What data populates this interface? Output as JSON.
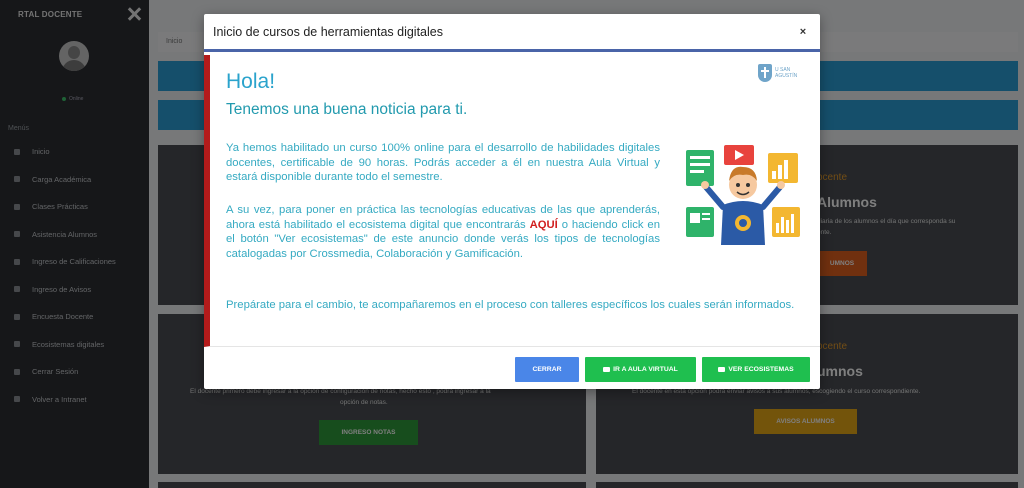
{
  "sidebar": {
    "brand": "RTAL DOCENTE",
    "status": "Online",
    "menu_title": "Menús",
    "items": [
      {
        "label": "Inicio"
      },
      {
        "label": "Carga Académica"
      },
      {
        "label": "Clases Prácticas"
      },
      {
        "label": "Asistencia Alumnos"
      },
      {
        "label": "Ingreso de Calificaciones"
      },
      {
        "label": "Ingreso de Avisos"
      },
      {
        "label": "Encuesta Docente"
      },
      {
        "label": "Ecosistemas digitales"
      },
      {
        "label": "Cerrar Sesión"
      },
      {
        "label": "Volver a Intranet"
      }
    ]
  },
  "main": {
    "breadcrumb": "Inicio",
    "card_r1": {
      "tag": "ocente",
      "title": "Alumnos",
      "text_line1": "diaria de los alumnos el día que corresponda su",
      "text_line2": "ente.",
      "button": "UMNOS"
    },
    "card_l2": {
      "text_line1": "El docente primero debe ingresar a la opción de configuración de notas, hecho esto , podrá ingresar a la",
      "text_line2": "opción de notas.",
      "button": "INGRESO NOTAS"
    },
    "card_r2": {
      "tag": "ocente",
      "title": "umnos",
      "text_line1": "El docente en esta opción podrá enviar avisos a sus alumnos, escogiendo el curso correspondiente.",
      "button": "AVISOS ALUMNOS"
    }
  },
  "modal": {
    "title": "Inicio de cursos de herramientas digitales",
    "close": "×",
    "logo_text_1": "U SAN",
    "logo_text_2": "AGUSTÍN",
    "greeting": "Hola!",
    "subtitle": "Tenemos una buena noticia para ti.",
    "paragraph1": "Ya hemos habilitado un curso 100% online para el desarrollo de habilidades digitales docentes, certificable de 90 horas. Podrás acceder a él en nuestra Aula Virtual y estará disponible durante todo el semestre.",
    "paragraph2_before": "A su vez, para poner en práctica las tecnologías educativas de las que aprenderás, ahora está habilitado el ecosistema digital que encontrarás ",
    "paragraph2_link": "AQUÍ",
    "paragraph2_after": " o haciendo click en el botón \"Ver ecosistemas\" de este anuncio donde verás los tipos de tecnologías catalogadas por Crossmedia, Colaboración y Gamificación.",
    "paragraph3": "Prepárate para el cambio, te acompañaremos en el proceso con talleres específicos los cuales serán informados.",
    "buttons": {
      "close": "CERRAR",
      "aula": "IR A AULA VIRTUAL",
      "eco": "VER ECOSISTEMAS"
    }
  },
  "colors": {
    "accent_blue": "#2a9fd6",
    "modal_header_line": "#4a64a8",
    "modal_left_bar": "#b31b1b",
    "button_primary": "#4a86e8",
    "button_success": "#1fbf4f"
  }
}
